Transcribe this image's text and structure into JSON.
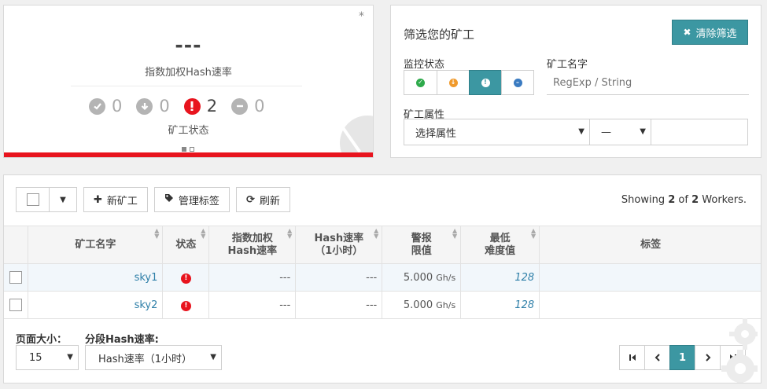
{
  "summary": {
    "corner_mark": "*",
    "hashrate_value": "---",
    "hashrate_label": "指数加权Hash速率",
    "status_label": "矿工状态",
    "status_counts": [
      {
        "icon": "check-circle-icon",
        "count": "0"
      },
      {
        "icon": "arrow-down-circle-icon",
        "count": "0"
      },
      {
        "icon": "exclamation-circle-icon",
        "count": "2"
      },
      {
        "icon": "minus-circle-icon",
        "count": "0"
      }
    ],
    "pager_dots": 2,
    "active_dot": 0,
    "accent_color": "#e8141e"
  },
  "filter": {
    "title": "筛选您的矿工",
    "clear_button": "清除筛选",
    "monitor_label": "监控状态",
    "name_label": "矿工名字",
    "name_placeholder": "RegExp / String",
    "attr_label": "矿工属性",
    "attr_select": "选择属性",
    "op_select": "—",
    "states": [
      {
        "icon": "check-circle-icon",
        "active": false
      },
      {
        "icon": "arrow-down-circle-icon",
        "active": false
      },
      {
        "icon": "exclamation-circle-icon",
        "active": true
      },
      {
        "icon": "minus-circle-icon",
        "active": false
      }
    ],
    "accent_color": "#3c97a2"
  },
  "toolbar": {
    "new_worker": "新矿工",
    "manage_tags": "管理标签",
    "refresh": "刷新",
    "showing_prefix": "Showing",
    "showing_count": "2",
    "showing_of": "of",
    "showing_total": "2",
    "showing_suffix": "Workers."
  },
  "table": {
    "headers": {
      "name": "矿工名字",
      "status": "状态",
      "ewh_1": "指数加权",
      "ewh_2": "Hash速率",
      "h1_1": "Hash速率",
      "h1_2": "（1小时）",
      "alert_1": "警报",
      "alert_2": "限值",
      "diff_1": "最低",
      "diff_2": "难度值",
      "tags": "标签"
    },
    "rows": [
      {
        "name": "sky1",
        "ewh": "---",
        "h1": "---",
        "alert_value": "5.000",
        "alert_unit": "Gh/s",
        "min_diff": "128",
        "tags": ""
      },
      {
        "name": "sky2",
        "ewh": "---",
        "h1": "---",
        "alert_value": "5.000",
        "alert_unit": "Gh/s",
        "min_diff": "128",
        "tags": ""
      }
    ]
  },
  "footer": {
    "page_size_label": "页面大小：",
    "page_size_value": "15",
    "segment_label": "分段Hash速率:",
    "segment_value": "Hash速率（1小时）",
    "current_page": "1"
  }
}
